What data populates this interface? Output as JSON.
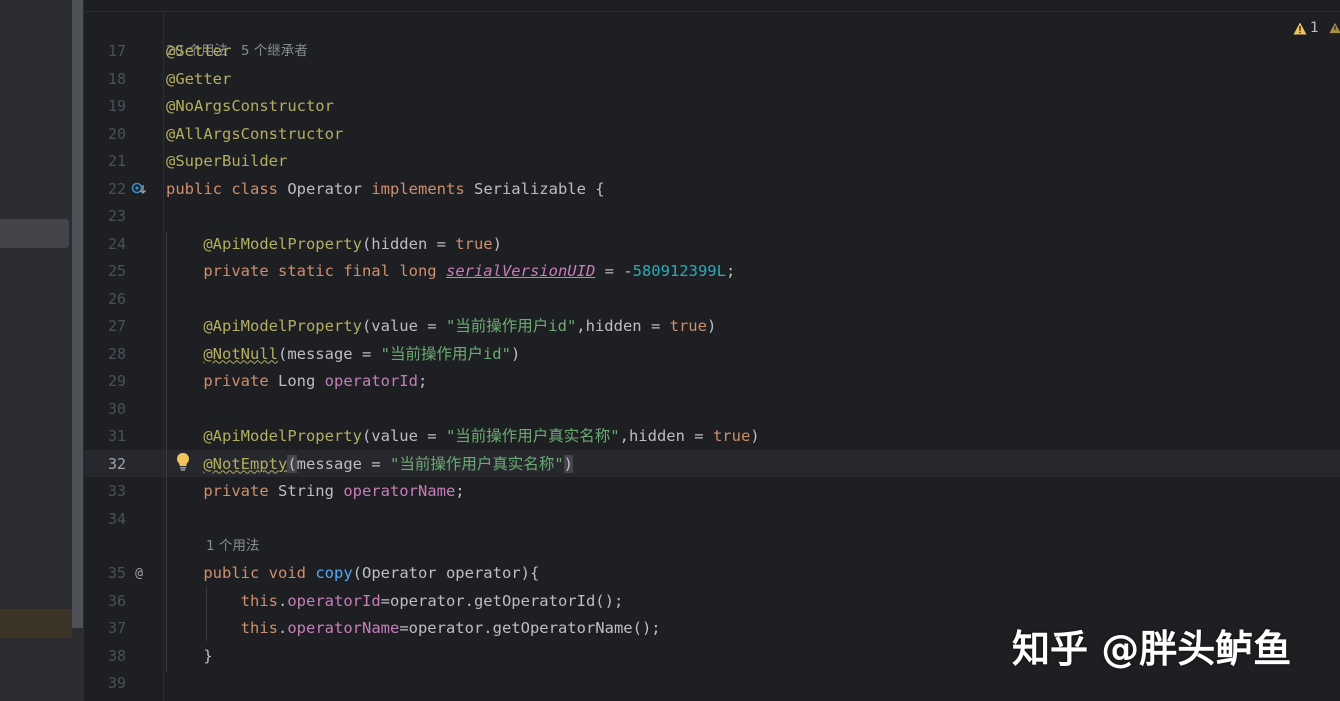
{
  "editor": {
    "hint_top": "20 个用法   5 个继承者",
    "current_line": 32,
    "lines": [
      {
        "n": "17",
        "tokens": [
          [
            "ann",
            "@Setter"
          ]
        ]
      },
      {
        "n": "18",
        "tokens": [
          [
            "ann",
            "@Getter"
          ]
        ]
      },
      {
        "n": "19",
        "tokens": [
          [
            "ann",
            "@NoArgsConstructor"
          ]
        ]
      },
      {
        "n": "20",
        "tokens": [
          [
            "ann",
            "@AllArgsConstructor"
          ]
        ]
      },
      {
        "n": "21",
        "tokens": [
          [
            "ann",
            "@SuperBuilder"
          ]
        ]
      },
      {
        "n": "22",
        "tokens": [
          [
            "kw",
            "public "
          ],
          [
            "kw",
            "class "
          ],
          [
            "",
            "Operator "
          ],
          [
            "kw",
            "implements "
          ],
          [
            "",
            "Serializable {"
          ]
        ]
      },
      {
        "n": "23",
        "tokens": []
      },
      {
        "n": "24",
        "tokens": [
          [
            "",
            "    "
          ],
          [
            "ann",
            "@ApiModelProperty"
          ],
          [
            "",
            "(hidden = "
          ],
          [
            "kw",
            "true"
          ],
          [
            "",
            ")"
          ]
        ]
      },
      {
        "n": "25",
        "tokens": [
          [
            "",
            "    "
          ],
          [
            "kw",
            "private "
          ],
          [
            "kw",
            "static "
          ],
          [
            "kw",
            "final "
          ],
          [
            "kw",
            "long "
          ],
          [
            "static-fld",
            "serialVersionUID"
          ],
          [
            "",
            " = -"
          ],
          [
            "num",
            "580912399L"
          ],
          [
            "",
            ";"
          ]
        ]
      },
      {
        "n": "26",
        "tokens": []
      },
      {
        "n": "27",
        "tokens": [
          [
            "",
            "    "
          ],
          [
            "ann",
            "@ApiModelProperty"
          ],
          [
            "",
            "(value = "
          ],
          [
            "str",
            "\"当前操作用户id\""
          ],
          [
            "",
            ",hidden = "
          ],
          [
            "kw",
            "true"
          ],
          [
            "",
            ")"
          ]
        ]
      },
      {
        "n": "28",
        "tokens": [
          [
            "",
            "    "
          ],
          [
            "ann warn-under",
            "@NotNull"
          ],
          [
            "",
            "(message = "
          ],
          [
            "str",
            "\"当前操作用户id\""
          ],
          [
            "",
            ")"
          ]
        ]
      },
      {
        "n": "29",
        "tokens": [
          [
            "",
            "    "
          ],
          [
            "kw",
            "private "
          ],
          [
            "",
            "Long "
          ],
          [
            "fld",
            "operatorId"
          ],
          [
            "",
            ";"
          ]
        ]
      },
      {
        "n": "30",
        "tokens": []
      },
      {
        "n": "31",
        "tokens": [
          [
            "",
            "    "
          ],
          [
            "ann",
            "@ApiModelProperty"
          ],
          [
            "",
            "(value = "
          ],
          [
            "str",
            "\"当前操作用户真实名称\""
          ],
          [
            "",
            ",hidden = "
          ],
          [
            "kw",
            "true"
          ],
          [
            "",
            ")"
          ]
        ]
      },
      {
        "n": "32",
        "tokens": [
          [
            "",
            "    "
          ],
          [
            "ann warn-under",
            "@NotEmpty"
          ],
          [
            "caret-bg",
            "("
          ],
          [
            "",
            "message = "
          ],
          [
            "str",
            "\"当前操作用户真实名称\""
          ],
          [
            "caret-bg",
            ")"
          ]
        ]
      },
      {
        "n": "33",
        "tokens": [
          [
            "",
            "    "
          ],
          [
            "kw",
            "private "
          ],
          [
            "",
            "String "
          ],
          [
            "fld",
            "operatorName"
          ],
          [
            "",
            ";"
          ]
        ]
      },
      {
        "n": "34",
        "tokens": []
      },
      {
        "n": "hint",
        "text": "1 个用法"
      },
      {
        "n": "35",
        "tokens": [
          [
            "",
            "    "
          ],
          [
            "kw",
            "public "
          ],
          [
            "kw",
            "void "
          ],
          [
            "fn",
            "copy"
          ],
          [
            "",
            "(Operator operator){"
          ]
        ]
      },
      {
        "n": "36",
        "tokens": [
          [
            "",
            "        "
          ],
          [
            "kw",
            "this"
          ],
          [
            "",
            "."
          ],
          [
            "fld",
            "operatorId"
          ],
          [
            "",
            "=operator.getOperatorId();"
          ]
        ]
      },
      {
        "n": "37",
        "tokens": [
          [
            "",
            "        "
          ],
          [
            "kw",
            "this"
          ],
          [
            "",
            "."
          ],
          [
            "fld",
            "operatorName"
          ],
          [
            "",
            "=operator.getOperatorName();"
          ]
        ]
      },
      {
        "n": "38",
        "tokens": [
          [
            "",
            "    }"
          ]
        ]
      },
      {
        "n": "39",
        "tokens": []
      }
    ]
  },
  "warnings": {
    "count": "1"
  },
  "icons": {
    "gutter_22": "implementation-marker-icon",
    "gutter_35": "annotation-at-icon",
    "line_32": "lightbulb-icon",
    "warning": "warning-triangle-icon"
  },
  "watermark": "知乎 @胖头鲈鱼",
  "colors": {
    "background": "#1e1f22",
    "keyword": "#cf8e6d",
    "annotation": "#b3ae60",
    "string": "#6aab73",
    "number": "#2aacb8",
    "field": "#c77dbb",
    "function": "#56a8f5"
  }
}
